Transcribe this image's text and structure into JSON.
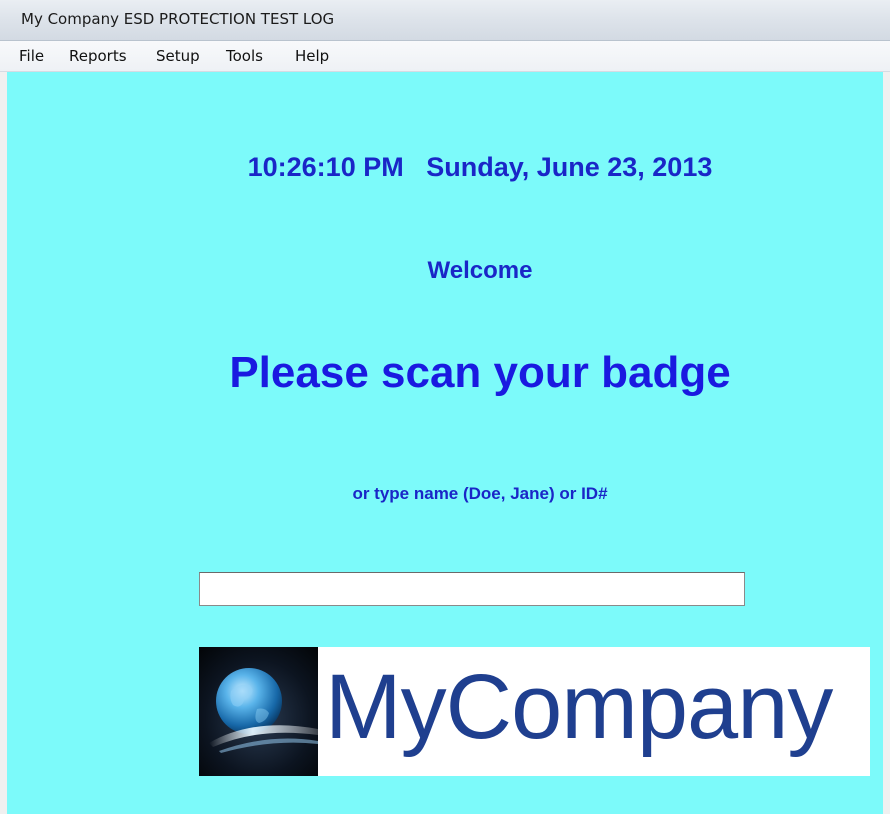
{
  "window": {
    "title": "My Company ESD PROTECTION TEST LOG"
  },
  "menu": {
    "items": [
      "File",
      "Reports",
      "Setup",
      "Tools",
      "Help"
    ]
  },
  "main": {
    "datetime": "10:26:10 PM   Sunday, June 23, 2013",
    "welcome": "Welcome",
    "prompt": "Please scan your badge",
    "hint": "or type name (Doe, Jane) or ID#",
    "input_value": ""
  },
  "logo": {
    "text": "MyCompany",
    "icon": "globe-icon"
  },
  "colors": {
    "background": "#7cfafa",
    "text_blue": "#1a26c7",
    "prompt_blue": "#1a1ae0",
    "logo_blue": "#1f3f8f"
  }
}
